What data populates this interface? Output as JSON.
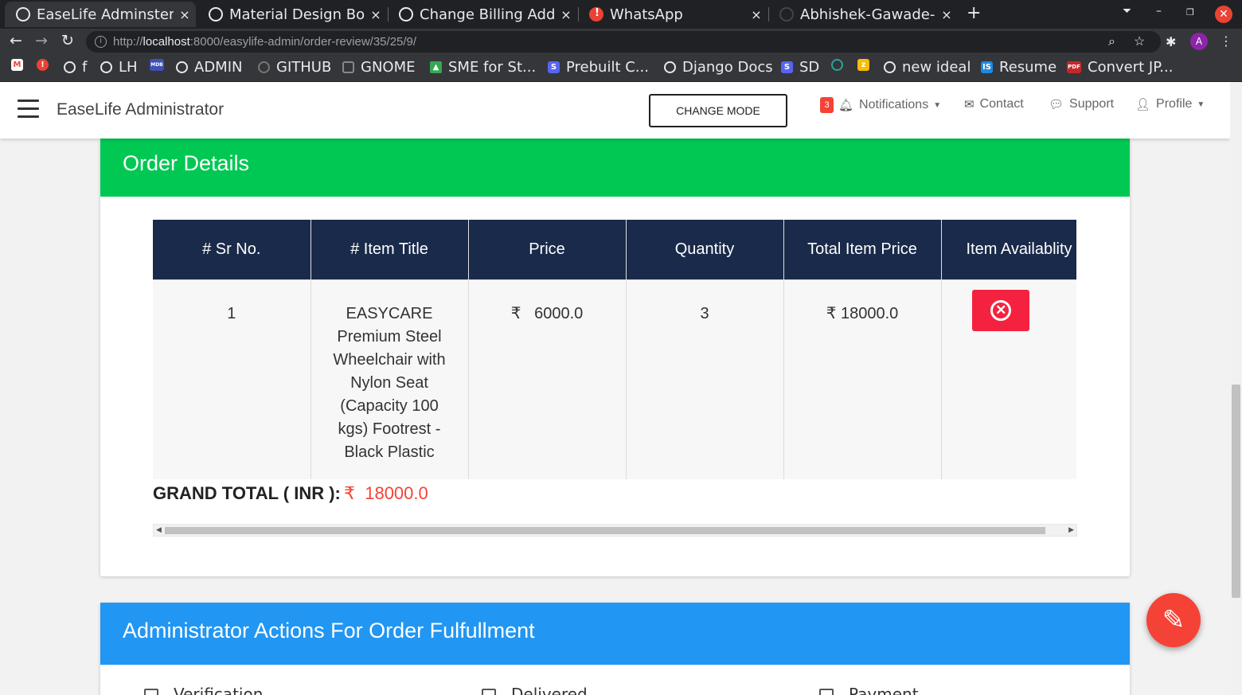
{
  "browser": {
    "tabs": [
      {
        "title": "EaseLife Adminster"
      },
      {
        "title": "Material Design Boo"
      },
      {
        "title": "Change Billing Addre"
      },
      {
        "title": "WhatsApp"
      },
      {
        "title": "Abhishek-Gawade-p"
      }
    ],
    "new_tab": "+",
    "close_glyph": "×",
    "url_prefix": "http://",
    "url_host": "localhost",
    "url_rest": ":8000/easylife-admin/order-review/35/25/9/",
    "avatar_letter": "A",
    "bookmarks": [
      "f",
      "LH",
      "ADMIN",
      "GITHUB",
      "GNOME",
      "SME for St...",
      "Prebuilt C...",
      "Django Docs",
      "SD",
      "new ideal",
      "Resume",
      "Convert JP..."
    ]
  },
  "app": {
    "brand": "EaseLife Administrator",
    "change_mode": "CHANGE MODE",
    "notifications_count": "3",
    "notifications_label": "Notifications",
    "contact_label": "Contact",
    "support_label": "Support",
    "profile_label": "Profile"
  },
  "order": {
    "header": "Order Details",
    "columns": [
      "# Sr No.",
      "# Item Title",
      "Price",
      "Quantity",
      "Total Item Price",
      "Item Availablity"
    ],
    "rows": [
      {
        "sr": "1",
        "title": "EASYCARE Premium Steel Wheelchair with Nylon Seat (Capacity 100 kgs) Footrest - Black Plastic",
        "price": "₹   6000.0",
        "quantity": "3",
        "total": "₹ 18000.0",
        "availability": "unavailable"
      }
    ],
    "grand_total_label": "GRAND TOTAL ( INR ):",
    "grand_total_value": "₹  18000.0"
  },
  "actions": {
    "header": "Administrator Actions For Order Fulfullment",
    "checkboxes": [
      "Verification",
      "Delivered",
      "Payment"
    ]
  },
  "colors": {
    "order_header": "#00c853",
    "actions_header": "#2196f3",
    "table_header": "#1a2a4a",
    "danger": "#f5223f",
    "fab": "#f44336"
  }
}
